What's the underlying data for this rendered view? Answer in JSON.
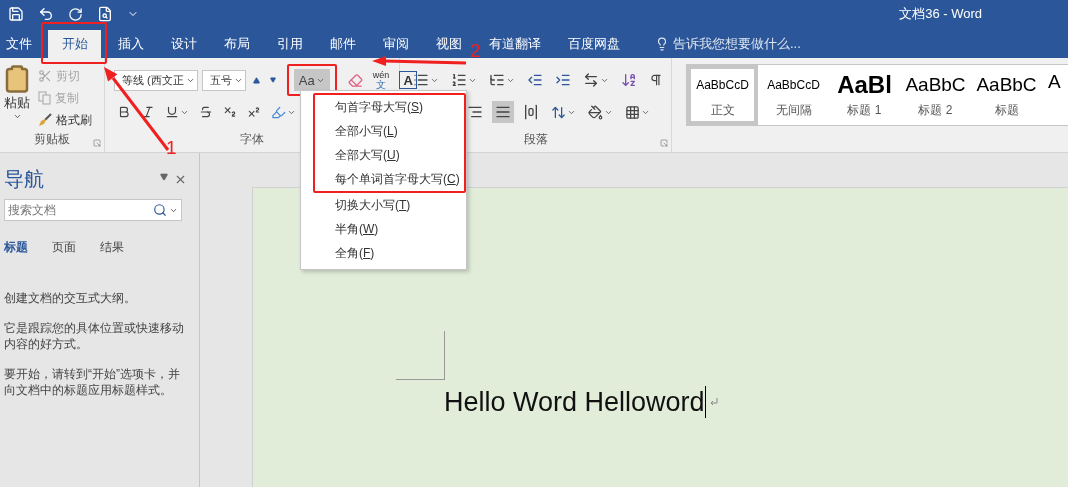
{
  "title_bar": {
    "title": "文档36 - Word"
  },
  "tabs": [
    {
      "label": "文件",
      "selected": false,
      "boxed": false
    },
    {
      "label": "开始",
      "selected": true,
      "boxed": true
    },
    {
      "label": "插入",
      "selected": false,
      "boxed": false
    },
    {
      "label": "设计",
      "selected": false,
      "boxed": false
    },
    {
      "label": "布局",
      "selected": false,
      "boxed": false
    },
    {
      "label": "引用",
      "selected": false,
      "boxed": false
    },
    {
      "label": "邮件",
      "selected": false,
      "boxed": false
    },
    {
      "label": "审阅",
      "selected": false,
      "boxed": false
    },
    {
      "label": "视图",
      "selected": false,
      "boxed": false
    },
    {
      "label": "有道翻译",
      "selected": false,
      "boxed": false
    },
    {
      "label": "百度网盘",
      "selected": false,
      "boxed": false
    }
  ],
  "tell_me": {
    "placeholder": "告诉我您想要做什么..."
  },
  "clipboard": {
    "group_label": "剪贴板",
    "paste": "粘贴",
    "commands": [
      {
        "kind": "cut",
        "label": "剪切",
        "disabled": true
      },
      {
        "kind": "copy",
        "label": "复制",
        "disabled": true
      },
      {
        "kind": "painter",
        "label": "格式刷",
        "disabled": false
      }
    ]
  },
  "font": {
    "group_label": "字体",
    "font_name": "等线 (西文正",
    "font_size": "五号",
    "change_case": {
      "label": "Aa",
      "pressed": true,
      "boxed": true
    },
    "phonetic_top": "wén",
    "phonetic_bottom": "文",
    "border_letter": "A"
  },
  "change_case_menu": {
    "items": [
      {
        "label": "句首字母大写(",
        "key": "S",
        "end": ")",
        "boxed": true
      },
      {
        "label": "全部小写(",
        "key": "L",
        "end": ")",
        "boxed": true
      },
      {
        "label": "全部大写(",
        "key": "U",
        "end": ")",
        "boxed": true
      },
      {
        "label": "每个单词首字母大写(",
        "key": "C",
        "end": ")",
        "boxed": true
      },
      {
        "label": "切换大小写(",
        "key": "T",
        "end": ")",
        "boxed": false
      },
      {
        "label": "半角(",
        "key": "W",
        "end": ")",
        "boxed": false
      },
      {
        "label": "全角(",
        "key": "F",
        "end": ")",
        "boxed": false
      }
    ]
  },
  "paragraph": {
    "group_label": "段落",
    "align_buttons": [
      {
        "kind": "right",
        "selected": false
      },
      {
        "kind": "justify",
        "selected": true
      },
      {
        "kind": "distributed",
        "selected": false
      }
    ]
  },
  "styles": [
    {
      "kind": "body",
      "sample": "AaBbCcD",
      "label": "正文",
      "selected": true
    },
    {
      "kind": "body",
      "sample": "AaBbCcD",
      "label": "无间隔",
      "selected": false
    },
    {
      "kind": "heading1",
      "sample": "AaBl",
      "label": "标题 1",
      "selected": false
    },
    {
      "kind": "heading2",
      "sample": "AaBbC",
      "label": "标题 2",
      "selected": false
    },
    {
      "kind": "heading2",
      "sample": "AaBbC",
      "label": "标题",
      "selected": false
    },
    {
      "kind": "heading2",
      "sample": "A",
      "selected": false
    }
  ],
  "navigation": {
    "title": "导航",
    "search": {
      "placeholder": "搜索文档"
    },
    "tabs": [
      {
        "label": "标题",
        "selected": true
      },
      {
        "label": "页面",
        "selected": false
      },
      {
        "label": "结果",
        "selected": false
      }
    ],
    "paragraphs": [
      "创建文档的交互式大纲。",
      "它是跟踪您的具体位置或快速移动内容的好方式。",
      "要开始，请转到“开始”选项卡，并向文档中的标题应用标题样式。"
    ]
  },
  "document": {
    "text": "Hello Word Helloword"
  },
  "annotations": [
    {
      "label": "1"
    },
    {
      "label": "2"
    }
  ]
}
